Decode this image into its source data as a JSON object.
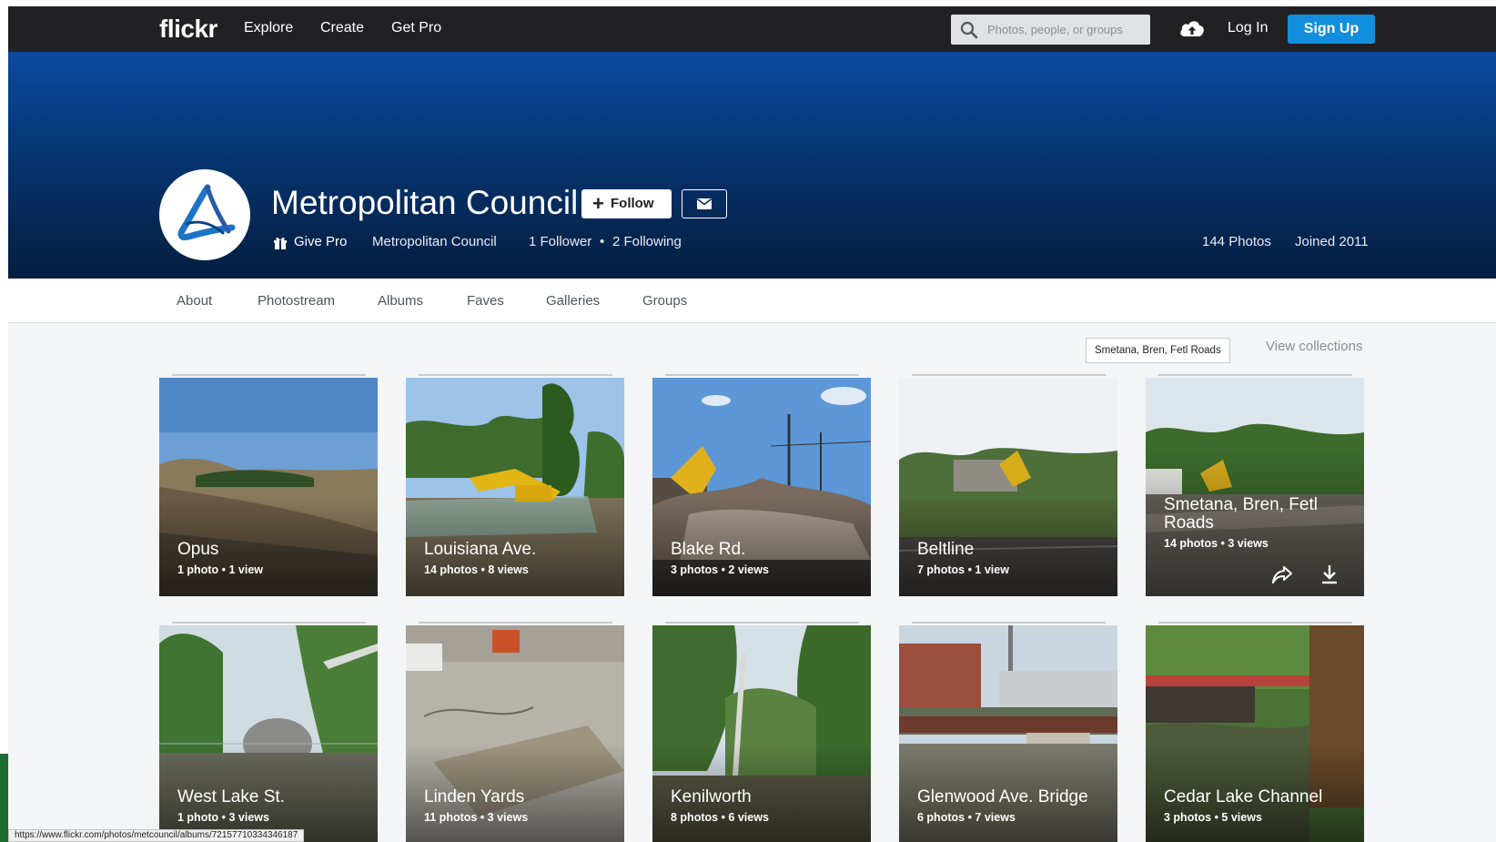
{
  "nav": {
    "logo": "flickr",
    "links": [
      "Explore",
      "Create",
      "Get Pro"
    ],
    "search_placeholder": "Photos, people, or groups",
    "login": "Log In",
    "signup": "Sign Up",
    "upload_icon": "cloud-upload-icon"
  },
  "profile": {
    "name": "Metropolitan Council",
    "follow_label": "Follow",
    "give_pro": "Give Pro",
    "real_name": "Metropolitan Council",
    "followers": "1 Follower",
    "following": "2 Following",
    "photos": "144 Photos",
    "joined": "Joined 2011"
  },
  "tabs": [
    "About",
    "Photostream",
    "Albums",
    "Faves",
    "Galleries",
    "Groups"
  ],
  "albums_section": {
    "tooltip": "Smetana, Bren, Fetl Roads",
    "view_collections": "View collections"
  },
  "albums": [
    {
      "title": "Opus",
      "photos": "1 photo",
      "views": "1 view"
    },
    {
      "title": "Louisiana Ave.",
      "photos": "14 photos",
      "views": "8 views"
    },
    {
      "title": "Blake Rd.",
      "photos": "3 photos",
      "views": "2 views"
    },
    {
      "title": "Beltline",
      "photos": "7 photos",
      "views": "1 view"
    },
    {
      "title": "Smetana, Bren, Fetl Roads",
      "photos": "14 photos",
      "views": "3 views"
    },
    {
      "title": "West Lake St.",
      "photos": "1 photo",
      "views": "3 views"
    },
    {
      "title": "Linden Yards",
      "photos": "11 photos",
      "views": "3 views"
    },
    {
      "title": "Kenilworth",
      "photos": "8 photos",
      "views": "6 views"
    },
    {
      "title": "Glenwood Ave. Bridge",
      "photos": "6 photos",
      "views": "7 views"
    },
    {
      "title": "Cedar Lake Channel",
      "photos": "3 photos",
      "views": "5 views"
    }
  ],
  "status_url": "https://www.flickr.com/photos/metcouncil/albums/72157710334346187",
  "colors": {
    "nav_bg": "#212124",
    "signup_blue": "#128fdc",
    "cover_blue": "#073a7d",
    "page_bg": "#f3f5f6"
  }
}
